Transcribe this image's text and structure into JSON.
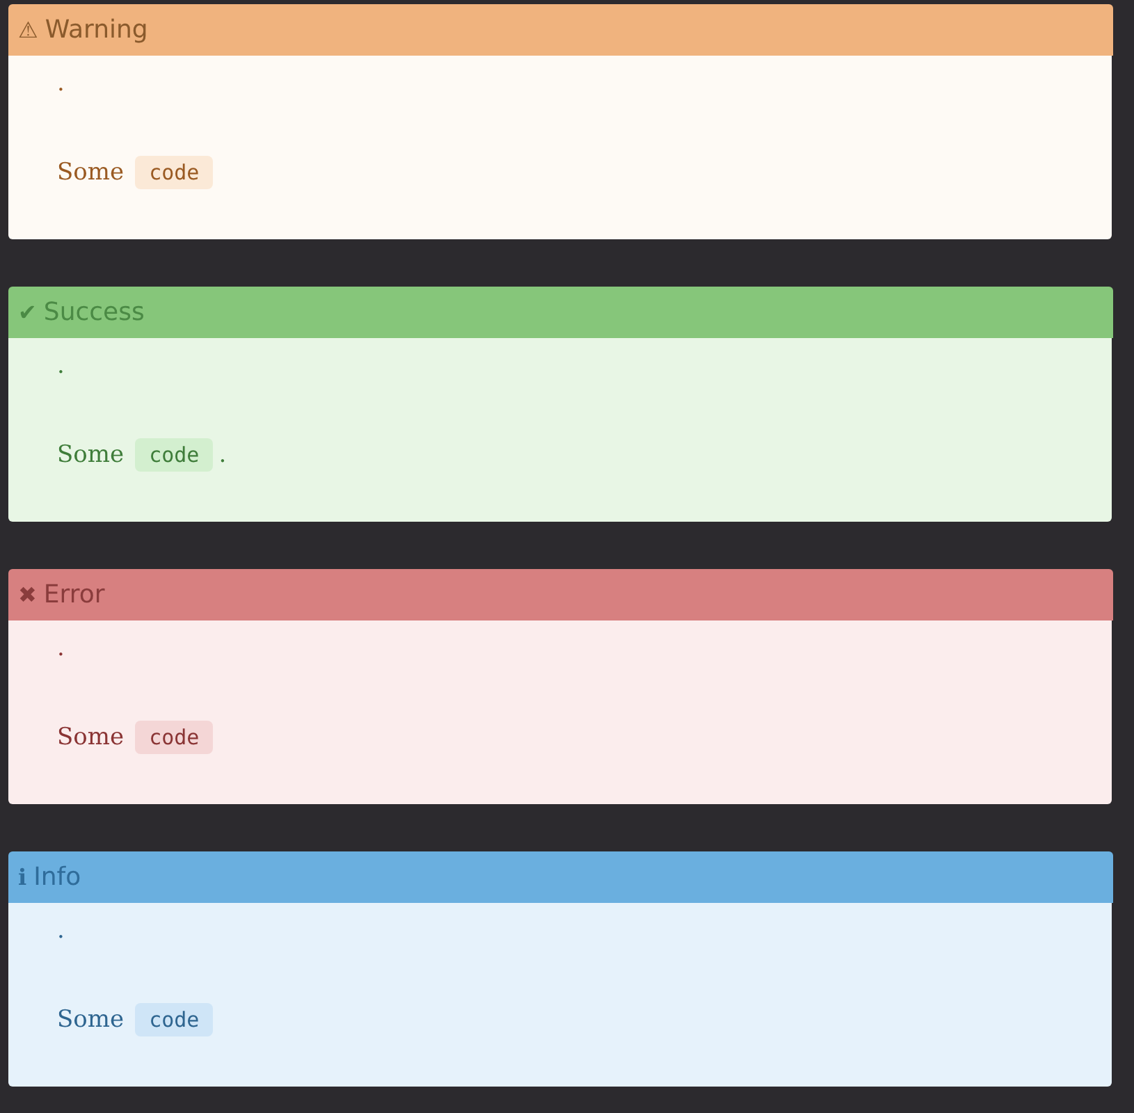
{
  "admonitions": [
    {
      "kind": "warning",
      "icon": "⚠",
      "title": "Warning",
      "paragraphs": [
        [
          {
            "kind": "text",
            "text": "."
          }
        ],
        [
          {
            "kind": "text",
            "text": "Some"
          },
          {
            "kind": "code",
            "text": "code"
          }
        ]
      ]
    },
    {
      "kind": "success",
      "icon": "✔",
      "title": "Success",
      "paragraphs": [
        [
          {
            "kind": "text",
            "text": "."
          }
        ],
        [
          {
            "kind": "text",
            "text": "Some"
          },
          {
            "kind": "code",
            "text": "code"
          },
          {
            "kind": "text",
            "text": "."
          }
        ]
      ]
    },
    {
      "kind": "error",
      "icon": "✖",
      "title": "Error",
      "paragraphs": [
        [
          {
            "kind": "text",
            "text": "."
          }
        ],
        [
          {
            "kind": "text",
            "text": "Some"
          },
          {
            "kind": "code",
            "text": "code"
          }
        ]
      ]
    },
    {
      "kind": "info",
      "icon": "ℹ",
      "title": "Info",
      "paragraphs": [
        [
          {
            "kind": "text",
            "text": "."
          }
        ],
        [
          {
            "kind": "text",
            "text": "Some"
          },
          {
            "kind": "code",
            "text": "code"
          }
        ]
      ]
    }
  ]
}
